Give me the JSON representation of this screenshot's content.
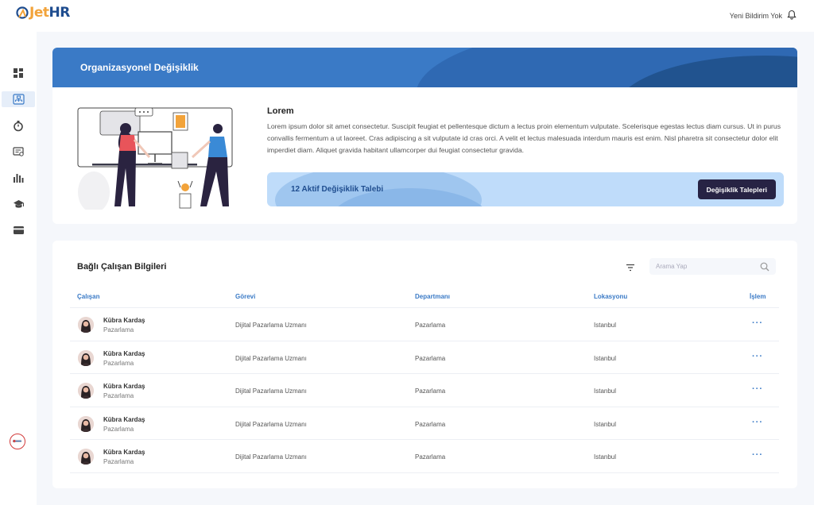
{
  "app": {
    "logo_text_jet": "Jet",
    "logo_text_hr": "HR"
  },
  "header": {
    "notification_text": "Yeni Bildirim Yok"
  },
  "sidebar": {
    "items": [
      {
        "icon": "dashboard-icon"
      },
      {
        "icon": "org-chart-icon",
        "active": true
      },
      {
        "icon": "stopwatch-icon"
      },
      {
        "icon": "document-badge-icon"
      },
      {
        "icon": "bar-chart-icon"
      },
      {
        "icon": "graduation-cap-icon"
      },
      {
        "icon": "wallet-card-icon"
      }
    ]
  },
  "org_card": {
    "title": "Organizasyonel Değişiklik",
    "lorem_title": "Lorem",
    "lorem_text": "Lorem ipsum dolor sit amet consectetur. Suscipit feugiat et pellentesque dictum a lectus proin elementum vulputate. Scelerisque egestas lectus diam cursus. Ut in purus convallis fermentum a ut laoreet. Cras adipiscing a sit vulputate id cras orci. A velit et lectus malesuada interdum mauris est enim. Nisl pharetra sit consectetur dolor elit imperdiet diam. Aliquet gravida habitant ullamcorper dui feugiat consectetur gravida.",
    "active_changes": "12 Aktif Değişiklik Talebi",
    "requests_button": "Değişiklik Talepleri"
  },
  "employees": {
    "title": "Bağlı Çalışan Bilgileri",
    "search_placeholder": "Arama Yap",
    "columns": [
      "Çalışan",
      "Görevi",
      "Departmanı",
      "Lokasyonu",
      "İşlem"
    ],
    "rows": [
      {
        "name": "Kübra Kardaş",
        "sub": "Pazarlama",
        "role": "Dijital Pazarlama Uzmanı",
        "dept": "Pazarlama",
        "loc": "Istanbul",
        "action": "···"
      },
      {
        "name": "Kübra Kardaş",
        "sub": "Pazarlama",
        "role": "Dijital Pazarlama Uzmanı",
        "dept": "Pazarlama",
        "loc": "Istanbul",
        "action": "···"
      },
      {
        "name": "Kübra Kardaş",
        "sub": "Pazarlama",
        "role": "Dijital Pazarlama Uzmanı",
        "dept": "Pazarlama",
        "loc": "Istanbul",
        "action": "···"
      },
      {
        "name": "Kübra Kardaş",
        "sub": "Pazarlama",
        "role": "Dijital Pazarlama Uzmanı",
        "dept": "Pazarlama",
        "loc": "Istanbul",
        "action": "···"
      },
      {
        "name": "Kübra Kardaş",
        "sub": "Pazarlama",
        "role": "Dijital Pazarlama Uzmanı",
        "dept": "Pazarlama",
        "loc": "Istanbul",
        "action": "···"
      }
    ]
  },
  "colors": {
    "primary": "#3a7ac6",
    "dark_button": "#272344",
    "accent_orange": "#f2a33a",
    "banner_light": "#bfdcfa"
  }
}
